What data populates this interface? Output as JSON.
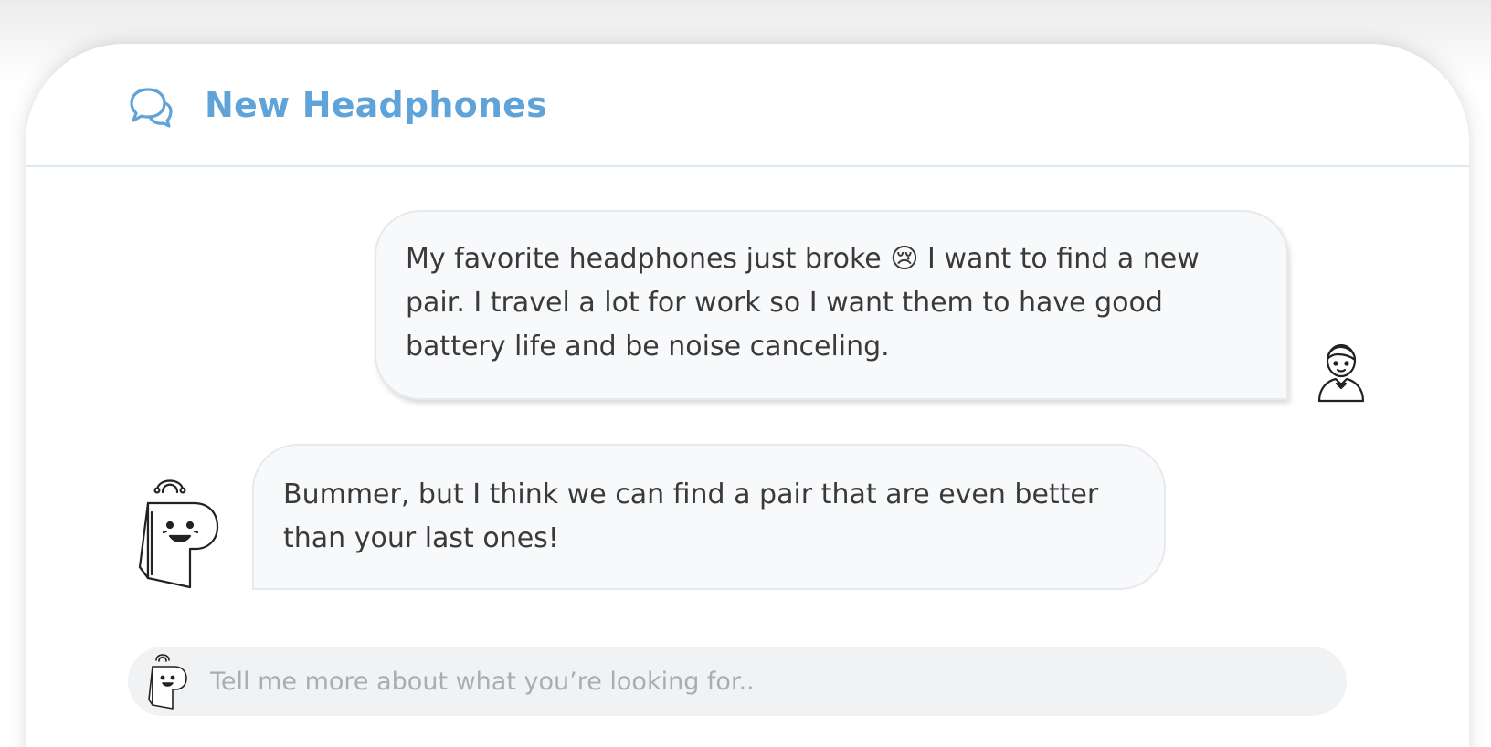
{
  "header": {
    "title": "New Headphones",
    "icon": "chat-bubbles-icon"
  },
  "messages": [
    {
      "sender": "user",
      "avatar": "user-avatar-icon",
      "text": "My favorite headphones just broke 😢 I want to find a new pair. I travel a lot for work so I want them to have good battery life and be noise canceling."
    },
    {
      "sender": "assistant",
      "avatar": "shopping-bag-mascot-icon",
      "text": "Bummer, but I think we can find a pair that are even better than your last ones!"
    }
  ],
  "composer": {
    "placeholder": "Tell me more about what you’re looking for..",
    "value": "",
    "icon": "shopping-bag-mascot-icon"
  },
  "colors": {
    "accent": "#5fa3d8",
    "bubble_bg": "#f8f9fa",
    "input_bg": "#f1f2f3",
    "text": "#3a3a3a",
    "placeholder": "#a9adb3"
  }
}
